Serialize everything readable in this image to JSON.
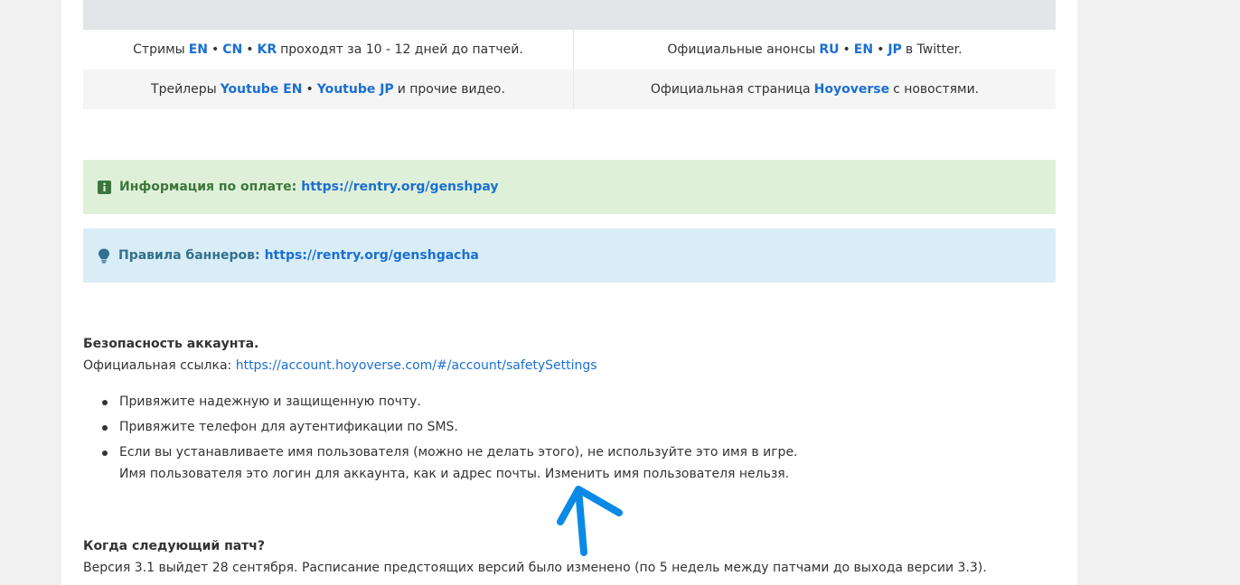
{
  "links_table": {
    "row1": {
      "left": {
        "prefix": "Стримы",
        "links": [
          "EN",
          "CN",
          "KR"
        ],
        "suffix": "проходят за 10 - 12 дней до патчей."
      },
      "right": {
        "prefix": "Официальные анонсы",
        "links": [
          "RU",
          "EN",
          "JP"
        ],
        "suffix": "в Twitter."
      }
    },
    "row2": {
      "left": {
        "prefix": "Трейлеры",
        "links": [
          "Youtube EN",
          "Youtube JP"
        ],
        "suffix": "и прочие видео."
      },
      "right": {
        "prefix": "Официальная страница",
        "links": [
          "Hoyoverse"
        ],
        "suffix": "с новостями."
      }
    },
    "separator": "•"
  },
  "alerts": {
    "payment": {
      "label": "Информация по оплате:",
      "link": "https://rentry.org/genshpay",
      "icon": "info-icon"
    },
    "banners": {
      "label": "Правила баннеров:",
      "link": "https://rentry.org/genshgacha",
      "icon": "lightbulb-icon"
    }
  },
  "security": {
    "title": "Безопасность аккаунта.",
    "official_label": "Официальная ссылка:",
    "official_link": "https://account.hoyoverse.com/#/account/safetySettings",
    "bullets": [
      "Привяжите надежную и защищенную почту.",
      "Привяжите телефон для аутентификации по SMS.",
      "Если вы устанавливаете имя пользователя (можно не делать этого), не используйте это имя в игре."
    ],
    "bullet3_line2": "Имя пользователя это логин для аккаунта, как и адрес почты. Изменить имя пользователя нельзя."
  },
  "next_patch": {
    "title": "Когда следующий патч?",
    "text": "Версия 3.1 выйдет 28 сентября. Расписание предстоящих версий было изменено (по 5 недель между патчами до выхода версии 3.3)."
  },
  "colors": {
    "link": "#1a6fd1",
    "green_bg": "#dff0d8",
    "green_text": "#3c763d",
    "blue_bg": "#d9edf7",
    "blue_text": "#31708f",
    "annotation_arrow": "#0a8ae6"
  }
}
